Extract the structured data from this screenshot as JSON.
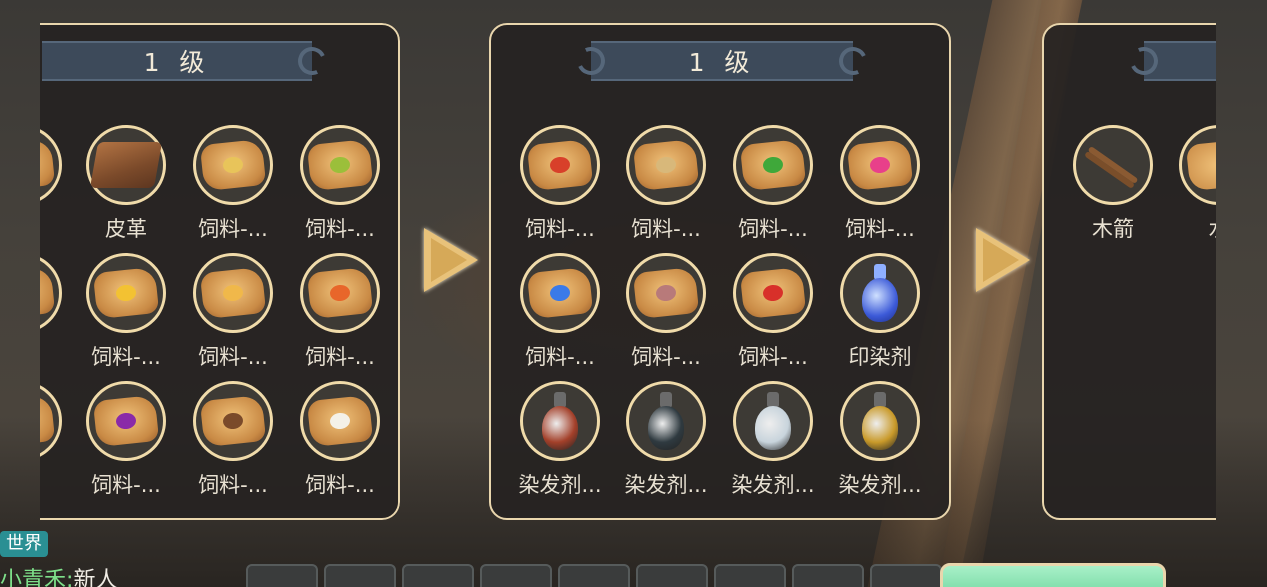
{
  "panels": [
    {
      "level_label": "1 级",
      "items": [
        {
          "label": "",
          "icon": "partial-item-icon"
        },
        {
          "label": "皮革",
          "icon": "leather-icon"
        },
        {
          "label": "饲料-...",
          "icon": "feed-pouch-grain-icon"
        },
        {
          "label": "饲料-...",
          "icon": "feed-pouch-leaf-icon"
        },
        {
          "label": "",
          "icon": "partial-item-icon"
        },
        {
          "label": "饲料-...",
          "icon": "feed-pouch-corn-icon"
        },
        {
          "label": "饲料-...",
          "icon": "feed-pouch-wheat-icon"
        },
        {
          "label": "饲料-...",
          "icon": "feed-pouch-carrot-icon"
        },
        {
          "label": "",
          "icon": "partial-item-icon"
        },
        {
          "label": "饲料-...",
          "icon": "feed-pouch-berry-icon"
        },
        {
          "label": "饲料-...",
          "icon": "feed-pouch-seeds-icon"
        },
        {
          "label": "饲料-...",
          "icon": "feed-pouch-flower-icon"
        }
      ]
    },
    {
      "level_label": "1 级",
      "items": [
        {
          "label": "饲料-...",
          "icon": "feed-pouch-mushroom-icon"
        },
        {
          "label": "饲料-...",
          "icon": "feed-pouch-nut-icon"
        },
        {
          "label": "饲料-...",
          "icon": "feed-pouch-pepper-icon"
        },
        {
          "label": "饲料-...",
          "icon": "feed-pouch-pink-flower-icon"
        },
        {
          "label": "饲料-...",
          "icon": "feed-pouch-blue-flower-icon"
        },
        {
          "label": "饲料-...",
          "icon": "feed-pouch-shell-icon"
        },
        {
          "label": "饲料-...",
          "icon": "feed-pouch-strawberry-icon"
        },
        {
          "label": "印染剂",
          "icon": "dye-bottle-icon"
        },
        {
          "label": "染发剂...",
          "icon": "hair-dye-red-icon"
        },
        {
          "label": "染发剂...",
          "icon": "hair-dye-black-icon"
        },
        {
          "label": "染发剂...",
          "icon": "hair-dye-white-icon"
        },
        {
          "label": "染发剂...",
          "icon": "hair-dye-gold-icon"
        }
      ]
    },
    {
      "level_label": "",
      "items": [
        {
          "label": "木箭",
          "icon": "wooden-arrow-icon"
        },
        {
          "label": "水",
          "icon": "water-item-icon"
        }
      ]
    }
  ],
  "chat": {
    "channel": "世界",
    "sender": "小青禾",
    "separator": ":",
    "message": "新人"
  },
  "colors": {
    "panel_border": "#e9d6ad",
    "banner": "#3d4a5a",
    "arrow": "#e8c27a",
    "chat_name": "#7ee08a",
    "chat_tag": "#2a8f93"
  }
}
